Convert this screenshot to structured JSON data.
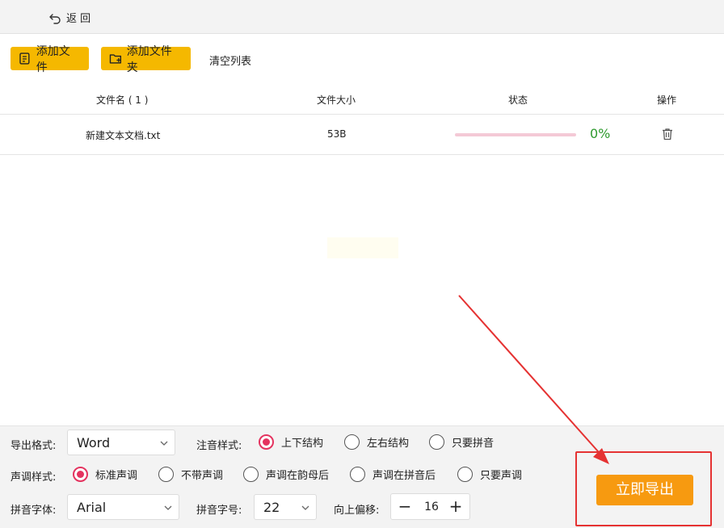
{
  "topbar": {
    "back_label": "返 回"
  },
  "toolbar": {
    "add_file": "添加文件",
    "add_folder": "添加文件夹",
    "clear_list": "清空列表"
  },
  "table": {
    "headers": {
      "name": "文件名 ( 1 )",
      "size": "文件大小",
      "status": "状态",
      "action": "操作"
    },
    "rows": [
      {
        "name": "新建文本文档.txt",
        "size": "53B",
        "progress_percent": 0,
        "progress_label": "0%",
        "action_icon": "trash-icon"
      }
    ]
  },
  "settings": {
    "export_format": {
      "label": "导出格式:",
      "value": "Word"
    },
    "annotation_style": {
      "label": "注音样式:",
      "options": [
        "上下结构",
        "左右结构",
        "只要拼音"
      ],
      "selected": 0
    },
    "tone_style": {
      "label": "声调样式:",
      "options": [
        "标准声调",
        "不带声调",
        "声调在韵母后",
        "声调在拼音后",
        "只要声调"
      ],
      "selected": 0
    },
    "pinyin_font": {
      "label": "拼音字体:",
      "value": "Arial"
    },
    "pinyin_size": {
      "label": "拼音字号:",
      "value": "22"
    },
    "offset_up": {
      "label": "向上偏移:",
      "value": "16",
      "minus": "−",
      "plus": "+"
    }
  },
  "export_button": "立即导出",
  "colors": {
    "toolbar_button": "#f5b800",
    "export_button": "#f79a10",
    "radio_selected": "#e4335f",
    "progress_text": "#2f9a2f",
    "annotation_red": "#e53232"
  }
}
